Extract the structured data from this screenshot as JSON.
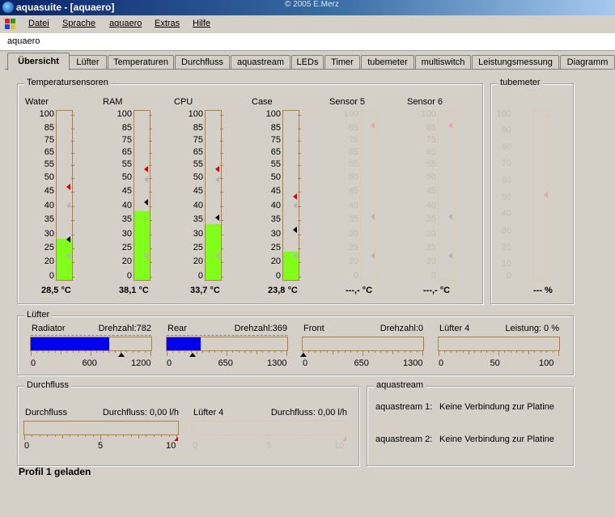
{
  "window": {
    "title": "aquasuite - [aquaero]",
    "copyright": "© 2005 E.Merz"
  },
  "menu": [
    "Datei",
    "Sprache",
    "aquaero",
    "Extras",
    "Hilfe"
  ],
  "subheader": "aquaero",
  "tabs": [
    "Übersicht",
    "Lüfter",
    "Temperaturen",
    "Durchfluss",
    "aquastream",
    "LEDs",
    "Timer",
    "tubemeter",
    "multiswitch",
    "Leistungsmessung",
    "Diagramm"
  ],
  "temperatures": {
    "group_title": "Temperatursensoren",
    "scale": [
      "100",
      "85",
      "75",
      "65",
      "55",
      "50",
      "45",
      "40",
      "35",
      "30",
      "25",
      "20",
      "0"
    ],
    "sensors": [
      {
        "name": "Water",
        "reading": "28,5 °C",
        "value": 28.5,
        "active": true
      },
      {
        "name": "RAM",
        "reading": "38,1 °C",
        "value": 38.1,
        "active": true
      },
      {
        "name": "CPU",
        "reading": "33,7 °C",
        "value": 33.7,
        "active": true
      },
      {
        "name": "Case",
        "reading": "23,8 °C",
        "value": 23.8,
        "active": true
      },
      {
        "name": "Sensor 5",
        "reading": "---,- °C",
        "value": 0,
        "active": false
      },
      {
        "name": "Sensor 6",
        "reading": "---,- °C",
        "value": 0,
        "active": false
      }
    ]
  },
  "tubemeter": {
    "group_title": "tubemeter",
    "scale": [
      "100",
      "90",
      "80",
      "70",
      "60",
      "50",
      "40",
      "30",
      "20",
      "10",
      "0"
    ],
    "reading": "--- %"
  },
  "fans": {
    "group_title": "Lüfter",
    "items": [
      {
        "name": "Radiator",
        "metric": "Drehzahl:782",
        "fill_fraction": 0.65,
        "scale": [
          "0",
          "600",
          "1200"
        ]
      },
      {
        "name": "Rear",
        "metric": "Drehzahl:369",
        "fill_fraction": 0.28,
        "scale": [
          "0",
          "650",
          "1300"
        ]
      },
      {
        "name": "Front",
        "metric": "Drehzahl:0",
        "fill_fraction": 0,
        "scale": [
          "0",
          "650",
          "1300"
        ]
      },
      {
        "name": "Lüfter 4",
        "metric": "Leistung: 0 %",
        "fill_fraction": 0,
        "scale": [
          "0",
          "50",
          "100"
        ]
      }
    ]
  },
  "flow": {
    "group_title": "Durchfluss",
    "items": [
      {
        "name": "Durchfluss",
        "metric": "Durchfluss: 0,00 l/h",
        "scale": [
          "0",
          "5",
          "10"
        ],
        "active": true
      },
      {
        "name": "Lüfter 4",
        "metric": "Durchfluss: 0,00 l/h",
        "scale": [
          "0",
          "5",
          "10"
        ],
        "active": false
      }
    ]
  },
  "aquastream": {
    "group_title": "aquastream",
    "rows": [
      {
        "label": "aquastream 1:",
        "status": "Keine Verbindung zur Platine"
      },
      {
        "label": "aquastream 2:",
        "status": "Keine Verbindung zur Platine"
      }
    ]
  },
  "status": "Profil 1 geladen",
  "colors": {
    "bar_green": "#7fff1a",
    "fan_blue": "#0000f0",
    "frame": "#b08040"
  }
}
